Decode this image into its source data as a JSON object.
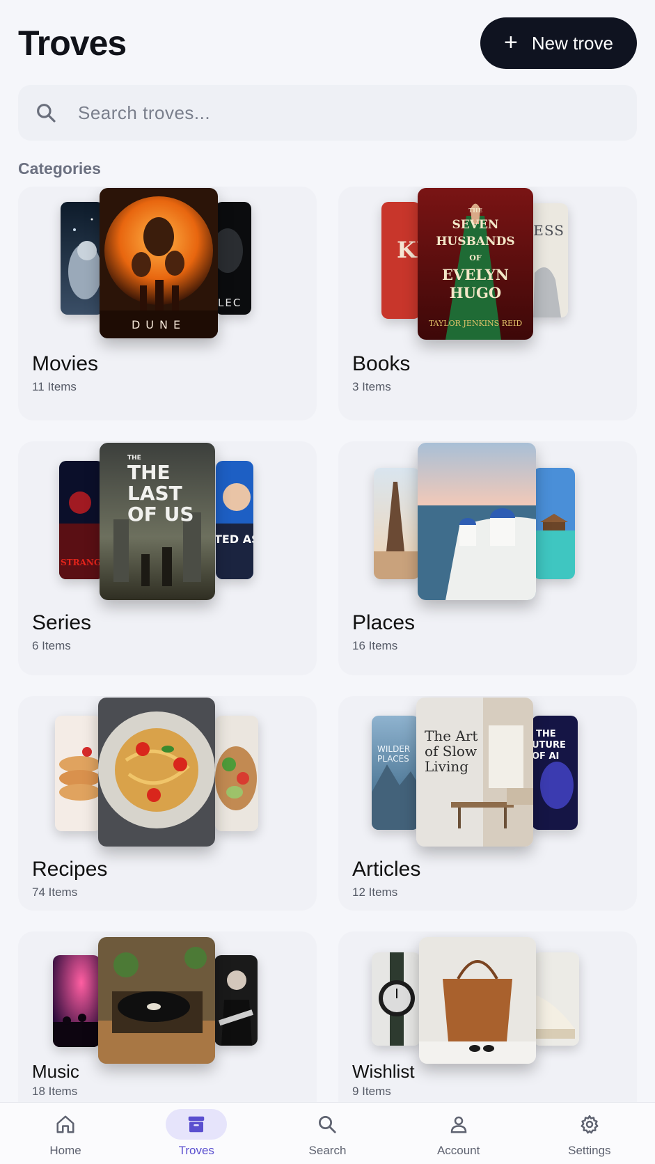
{
  "header": {
    "title": "Troves",
    "new_button": "New trove",
    "new_button_icon": "plus-icon"
  },
  "search": {
    "placeholder": "Search troves..."
  },
  "section_title": "Categories",
  "categories": [
    {
      "name": "Movies",
      "count": "11 Items",
      "covers": {
        "left": "space-astronaut",
        "main": "DUNE",
        "right": "LEC"
      }
    },
    {
      "name": "Books",
      "count": "3 Items",
      "covers": {
        "left": "KL HO",
        "main": [
          "THE",
          "SEVEN",
          "HUSBANDS",
          "OF",
          "EVELYN",
          "HUGO",
          "TAYLOR JENKINS REID"
        ],
        "right": "LESS ED"
      }
    },
    {
      "name": "Series",
      "count": "6 Items",
      "covers": {
        "left": "STRANGER THINGS",
        "main": [
          "THE",
          "THE",
          "LAST",
          "OF US"
        ],
        "right": "TED ASSO"
      }
    },
    {
      "name": "Places",
      "count": "16 Items",
      "covers": {
        "left": "eiffel-tower",
        "main": "santorini",
        "right": "overwater-bungalows"
      }
    },
    {
      "name": "Recipes",
      "count": "74 Items",
      "covers": {
        "left": "pancakes",
        "main": "spaghetti",
        "right": "salad-toast"
      }
    },
    {
      "name": "Articles",
      "count": "12 Items",
      "covers": {
        "left": [
          "WILDER",
          "PLACES"
        ],
        "main": [
          "The Art",
          "of Slow",
          "Living"
        ],
        "right": [
          "THE",
          "UTURE",
          "OF AI"
        ]
      }
    },
    {
      "name": "Music",
      "count": "18 Items",
      "covers": {
        "left": "concert",
        "main": "record-player",
        "right": "guitarist"
      }
    },
    {
      "name": "Wishlist",
      "count": "9 Items",
      "covers": {
        "left": "watch",
        "main": "leather-tote",
        "right": "sneaker"
      }
    }
  ],
  "nav": [
    {
      "label": "Home",
      "icon": "home-icon",
      "active": false
    },
    {
      "label": "Troves",
      "icon": "archive-box-icon",
      "active": true
    },
    {
      "label": "Search",
      "icon": "search-icon",
      "active": false
    },
    {
      "label": "Account",
      "icon": "user-icon",
      "active": false
    },
    {
      "label": "Settings",
      "icon": "gear-icon",
      "active": false
    }
  ],
  "colors": {
    "accent": "#5a4fcf",
    "button_bg": "#0f1320",
    "background": "#f5f6fa"
  }
}
